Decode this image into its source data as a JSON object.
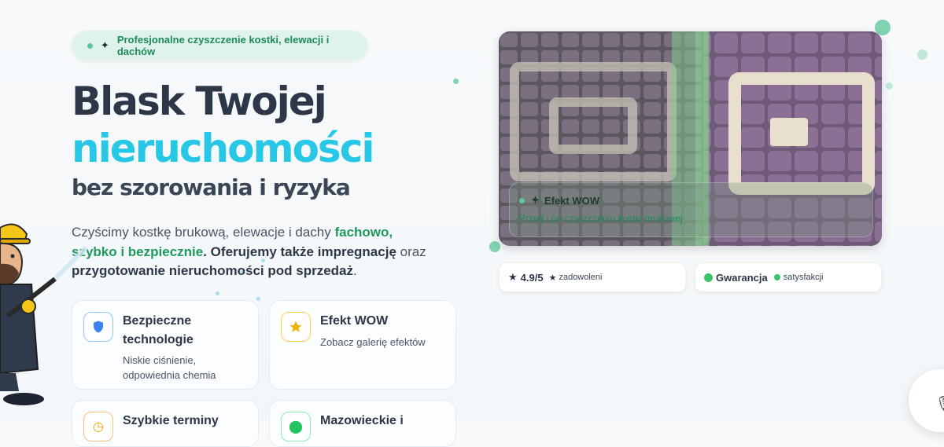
{
  "badge": {
    "text": "Profesjonalne czyszczenie kostki, elewacji i dachów"
  },
  "hero": {
    "title_line1": "Blask Twojej",
    "title_line2": "nieruchomości",
    "subtitle": "bez szorowania i ryzyka",
    "lead_1": "Czyścimy kostkę brukową, elewacje i dachy ",
    "lead_2": "fachowo, szybko i bezpiecznie",
    "lead_3": ". Oferujemy także ",
    "lead_4": "impregnację",
    "lead_5": " oraz ",
    "lead_6": "przygotowanie nieruchomości pod sprzedaż",
    "lead_7": "."
  },
  "features": [
    {
      "title": "Bezpieczne technologie",
      "subtitle": "Niskie ciśnienie, odpowiednia chemia",
      "icon": "shield-icon",
      "color": "#3b82f6"
    },
    {
      "title": "Efekt WOW",
      "subtitle": "Zobacz galerię efektów",
      "icon": "star-icon",
      "color": "#eab308"
    },
    {
      "title": "Szybkie terminy",
      "icon": "clock-icon",
      "color": "#f59e0b"
    },
    {
      "title": "Mazowieckie i",
      "icon": "pin-icon",
      "color": "#22c55e"
    }
  ],
  "photo": {
    "overlay_title": "Efekt WOW",
    "overlay_caption": "Przed i po czyszczeniu kostki brukowej"
  },
  "stats": {
    "rating": "4.9/5",
    "rating_label": "zadowoleni",
    "guarantee": "Gwarancja",
    "guarantee_label": "satysfakcji"
  },
  "colors": {
    "accent_cyan": "#29c7e6",
    "accent_green": "#1f9a5e",
    "text_dark": "#2d3748"
  }
}
